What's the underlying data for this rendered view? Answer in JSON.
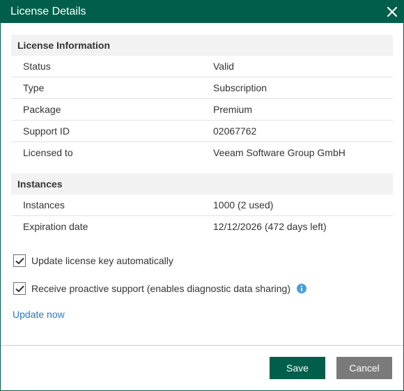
{
  "dialog": {
    "title": "License Details",
    "close_icon": "close-icon"
  },
  "license_info": {
    "header": "License Information",
    "rows": [
      {
        "label": "Status",
        "value": "Valid"
      },
      {
        "label": "Type",
        "value": "Subscription"
      },
      {
        "label": "Package",
        "value": "Premium"
      },
      {
        "label": "Support ID",
        "value": "02067762"
      },
      {
        "label": "Licensed to",
        "value": "Veeam Software Group GmbH"
      }
    ]
  },
  "instances": {
    "header": "Instances",
    "rows": [
      {
        "label": "Instances",
        "value": "1000 (2 used)"
      },
      {
        "label": "Expiration date",
        "value": "12/12/2026 (472 days left)"
      }
    ]
  },
  "options": {
    "auto_update": {
      "label": "Update license key automatically",
      "checked": true
    },
    "proactive_support": {
      "label": "Receive proactive support (enables diagnostic data sharing)",
      "checked": true,
      "icon": "info-icon"
    }
  },
  "update_link": "Update now",
  "buttons": {
    "save": "Save",
    "cancel": "Cancel"
  },
  "colors": {
    "brand": "#005f4b",
    "link": "#2b79c2",
    "info": "#4a9fd8",
    "cancel": "#7a7a7a"
  }
}
